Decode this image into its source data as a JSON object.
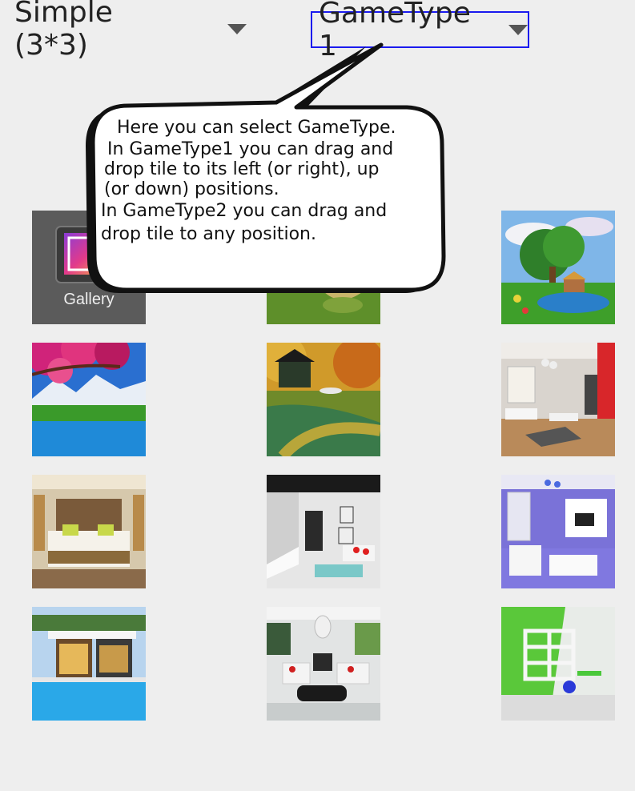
{
  "header": {
    "difficulty_value": "Simple (3*3)",
    "gametype_value": "GameType 1",
    "highlight_color": "#1a1aee"
  },
  "tooltip": {
    "lines": [
      "  Here you can select GameType.",
      " In GameType1 you can drag and",
      "drop tile to its left (or right), up",
      "(or down) positions.",
      "In GameType2 you can drag and",
      "drop tile to any position."
    ]
  },
  "gallery_tile": {
    "label": "Gallery",
    "icon": "gallery-icon"
  },
  "images": [
    {
      "row": 1,
      "col": 2,
      "subject": "landscape-path",
      "icon": "landscape-thumbnail"
    },
    {
      "row": 1,
      "col": 3,
      "subject": "painting-lake-house",
      "icon": "landscape-thumbnail"
    },
    {
      "row": 2,
      "col": 1,
      "subject": "cherry-blossom-lake",
      "icon": "landscape-thumbnail"
    },
    {
      "row": 2,
      "col": 2,
      "subject": "autumn-cabin-canal",
      "icon": "landscape-thumbnail"
    },
    {
      "row": 2,
      "col": 3,
      "subject": "living-room-red-wall",
      "icon": "interior-thumbnail"
    },
    {
      "row": 3,
      "col": 1,
      "subject": "bedroom",
      "icon": "interior-thumbnail"
    },
    {
      "row": 3,
      "col": 2,
      "subject": "modern-living-stairs",
      "icon": "interior-thumbnail"
    },
    {
      "row": 3,
      "col": 3,
      "subject": "purple-living-room",
      "icon": "interior-thumbnail"
    },
    {
      "row": 4,
      "col": 1,
      "subject": "house-with-pool",
      "icon": "exterior-thumbnail"
    },
    {
      "row": 4,
      "col": 2,
      "subject": "white-sofa-lounge",
      "icon": "interior-thumbnail"
    },
    {
      "row": 4,
      "col": 3,
      "subject": "green-wall-shelves",
      "icon": "interior-thumbnail"
    }
  ]
}
